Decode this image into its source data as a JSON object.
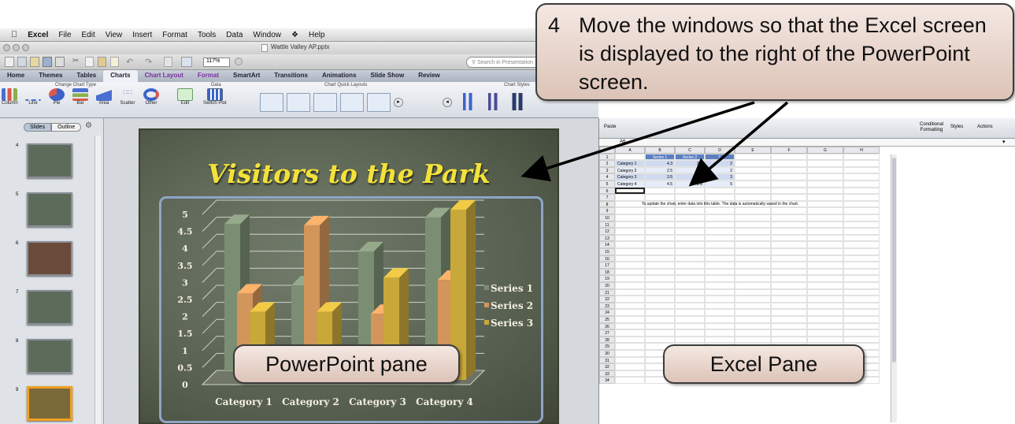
{
  "menubar": {
    "app": "Excel",
    "items": [
      "File",
      "Edit",
      "View",
      "Insert",
      "Format",
      "Tools",
      "Data",
      "Window",
      "Help"
    ]
  },
  "window": {
    "title": "Wattle Valley AP.pptx"
  },
  "search": {
    "placeholder": "Search in Presentation"
  },
  "zoom": "117%",
  "ribbon_tabs": [
    {
      "label": "Home"
    },
    {
      "label": "Themes"
    },
    {
      "label": "Tables"
    },
    {
      "label": "Charts",
      "selected": true
    },
    {
      "label": "Chart Layout"
    },
    {
      "label": "Format"
    },
    {
      "label": "SmartArt"
    },
    {
      "label": "Transitions"
    },
    {
      "label": "Animations"
    },
    {
      "label": "Slide Show"
    },
    {
      "label": "Review"
    }
  ],
  "ribbon_groups": {
    "change_chart_type": "Change Chart Type",
    "data": "Data",
    "chart_quick_layouts": "Chart Quick Layouts",
    "chart_styles": "Chart Styles"
  },
  "ribbon_buttons": [
    {
      "label": "Column",
      "icon": "column-chart-icon"
    },
    {
      "label": "Line",
      "icon": "line-chart-icon"
    },
    {
      "label": "Pie",
      "icon": "pie-chart-icon"
    },
    {
      "label": "Bar",
      "icon": "bar-chart-icon"
    },
    {
      "label": "Area",
      "icon": "area-chart-icon"
    },
    {
      "label": "Scatter",
      "icon": "scatter-chart-icon"
    },
    {
      "label": "Other",
      "icon": "other-chart-icon"
    },
    {
      "label": "Edit",
      "icon": "edit-data-icon"
    },
    {
      "label": "Switch Plot",
      "icon": "switch-plot-icon"
    }
  ],
  "sidebar": {
    "tabs": [
      "Slides",
      "Outline"
    ],
    "slide_numbers": [
      "4",
      "5",
      "6",
      "7",
      "8",
      "9"
    ]
  },
  "slide": {
    "title": "Visitors to the Park"
  },
  "chart_data": {
    "type": "bar",
    "categories": [
      "Category 1",
      "Category 2",
      "Category 3",
      "Category 4"
    ],
    "series": [
      {
        "name": "Series 1",
        "values": [
          4.3,
          2.5,
          3.5,
          4.5
        ]
      },
      {
        "name": "Series 2",
        "values": [
          2.4,
          4.4,
          1.8,
          2.8
        ]
      },
      {
        "name": "Series 3",
        "values": [
          2,
          2,
          3,
          5
        ]
      }
    ],
    "yticks": [
      "0",
      "0.5",
      "1",
      "1.5",
      "2",
      "2.5",
      "3",
      "3.5",
      "4",
      "4.5",
      "5"
    ],
    "ylim": [
      0,
      5
    ],
    "legend_position": "right",
    "colors": {
      "Series 1": "#7b8e74",
      "Series 2": "#d2955a",
      "Series 3": "#c9a83a"
    }
  },
  "excel": {
    "ribbon_labels": [
      "Paste",
      "Conditional Formatting",
      "Styles",
      "Actions"
    ],
    "cell_ref": "A6",
    "columns": [
      "A",
      "B",
      "C",
      "D",
      "E",
      "F",
      "G",
      "H"
    ],
    "headers": [
      "",
      "Series 1",
      "Series 2",
      "S"
    ],
    "rows": [
      [
        "Category 1",
        "4.3",
        "2.4",
        "2"
      ],
      [
        "Category 2",
        "2.5",
        "4.4",
        "2"
      ],
      [
        "Category 3",
        "3.5",
        "1.8",
        "3"
      ],
      [
        "Category 4",
        "4.5",
        "2.8",
        "5"
      ]
    ],
    "note": "To update the chart, enter data into this table. The data is automatically saved in the chart.",
    "row_numbers": [
      "1",
      "2",
      "3",
      "4",
      "5",
      "6",
      "7",
      "8",
      "9",
      "10",
      "11",
      "12",
      "13",
      "14",
      "15",
      "16",
      "17",
      "18",
      "19",
      "20",
      "21",
      "22",
      "23",
      "24",
      "25",
      "26",
      "27",
      "28",
      "29",
      "30",
      "31",
      "32",
      "33",
      "34"
    ]
  },
  "callouts": {
    "step_number": "4",
    "step_text": "Move the windows so that the Excel screen is displayed to the right of the PowerPoint screen.",
    "powerpoint_label": "PowerPoint pane",
    "excel_label": "Excel Pane"
  }
}
